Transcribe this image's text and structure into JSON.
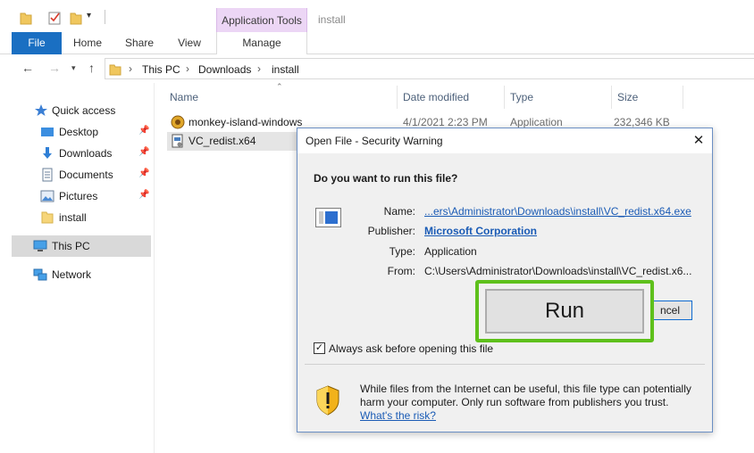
{
  "window": {
    "title": "install",
    "context_tab": "Application Tools"
  },
  "ribbon": {
    "tabs": [
      "File",
      "Home",
      "Share",
      "View",
      "Manage"
    ]
  },
  "address": {
    "crumbs": [
      "This PC",
      "Downloads",
      "install"
    ]
  },
  "sidebar": {
    "items": [
      {
        "label": "Quick access"
      },
      {
        "label": "Desktop"
      },
      {
        "label": "Downloads"
      },
      {
        "label": "Documents"
      },
      {
        "label": "Pictures"
      },
      {
        "label": "install"
      },
      {
        "label": "This PC"
      },
      {
        "label": "Network"
      }
    ]
  },
  "filelist": {
    "columns": [
      "Name",
      "Date modified",
      "Type",
      "Size"
    ],
    "rows": [
      {
        "name": "monkey-island-windows",
        "date": "4/1/2021 2:23 PM",
        "type": "Application",
        "size": "232,346 KB"
      },
      {
        "name": "VC_redist.x64"
      }
    ]
  },
  "dialog": {
    "title": "Open File - Security Warning",
    "question": "Do you want to run this file?",
    "name_label": "Name:",
    "name_value": "...ers\\Administrator\\Downloads\\install\\VC_redist.x64.exe",
    "publisher_label": "Publisher:",
    "publisher_value": "Microsoft Corporation",
    "type_label": "Type:",
    "type_value": "Application",
    "from_label": "From:",
    "from_value": "C:\\Users\\Administrator\\Downloads\\install\\VC_redist.x6...",
    "run_label": "Run",
    "cancel_label": "ncel",
    "always_ask_label": "Always ask before opening this file",
    "warning_text": "While files from the Internet can be useful, this file type can potentially harm your computer. Only run software from publishers you trust.",
    "risk_link": "What's the risk?"
  },
  "colors": {
    "file_tab": "#1a6fc2",
    "context_tab": "#ecd6f5",
    "highlight": "#5ec01b",
    "link": "#1a5bb5"
  }
}
